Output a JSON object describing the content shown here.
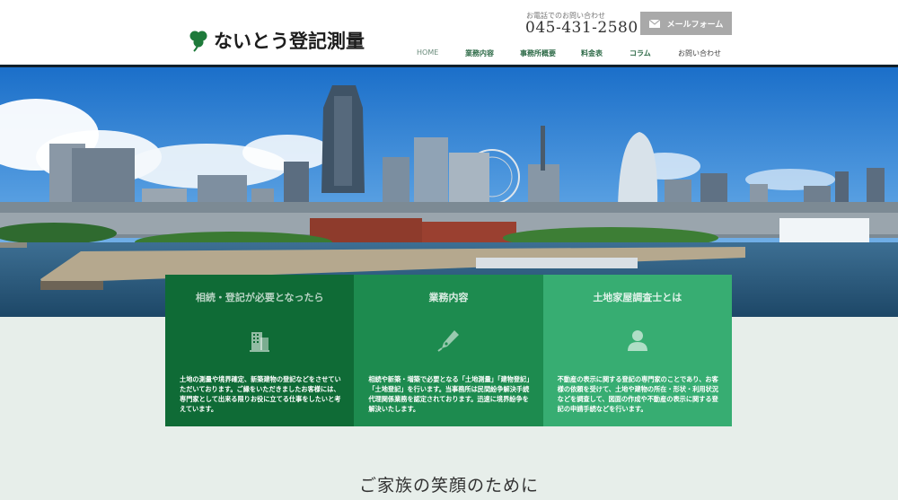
{
  "header": {
    "logo_text": "ないとう登記測量",
    "phone_label": "お電話でのお問い合わせ",
    "phone_number": "045-431-2580",
    "mail_button": "メールフォーム",
    "nav": [
      {
        "label": "HOME"
      },
      {
        "label": "業務内容"
      },
      {
        "label": "事務所概要"
      },
      {
        "label": "料金表"
      },
      {
        "label": "コラム"
      },
      {
        "label": "お問い合わせ"
      }
    ]
  },
  "hero": {
    "image": "yokohama-skyline-photo"
  },
  "cards": [
    {
      "title": "相続・登記が必要となったら",
      "icon": "building-icon",
      "desc": "土地の測量や境界確定、新築建物の登記などをさせていただいております。ご縁をいただきましたお客様には、専門家として出来る限りお役に立てる仕事をしたいと考えています。"
    },
    {
      "title": "業務内容",
      "icon": "pen-icon",
      "desc": "相続や新築・増築で必要となる「土地測量」「建物登記」「土地登記」を行います。当事務所は民間紛争解決手続代理関係業務を認定されております。迅速に境界紛争を解決いたします。"
    },
    {
      "title": "土地家屋調査士とは",
      "icon": "person-icon",
      "desc": "不動産の表示に関する登記の専門家のことであり、お客様の依頼を受けて、土地や建物の所在・形状・利用状況などを調査して、図面の作成や不動産の表示に関する登記の申請手続などを行います。"
    }
  ],
  "tagline": "ご家族の笑顔のために",
  "colors": {
    "card1": "#0f6b36",
    "card2": "#1d8b4f",
    "card3": "#37ad72",
    "nav_green": "#2d6a47",
    "mail_button_bg": "#a9a9a9"
  }
}
